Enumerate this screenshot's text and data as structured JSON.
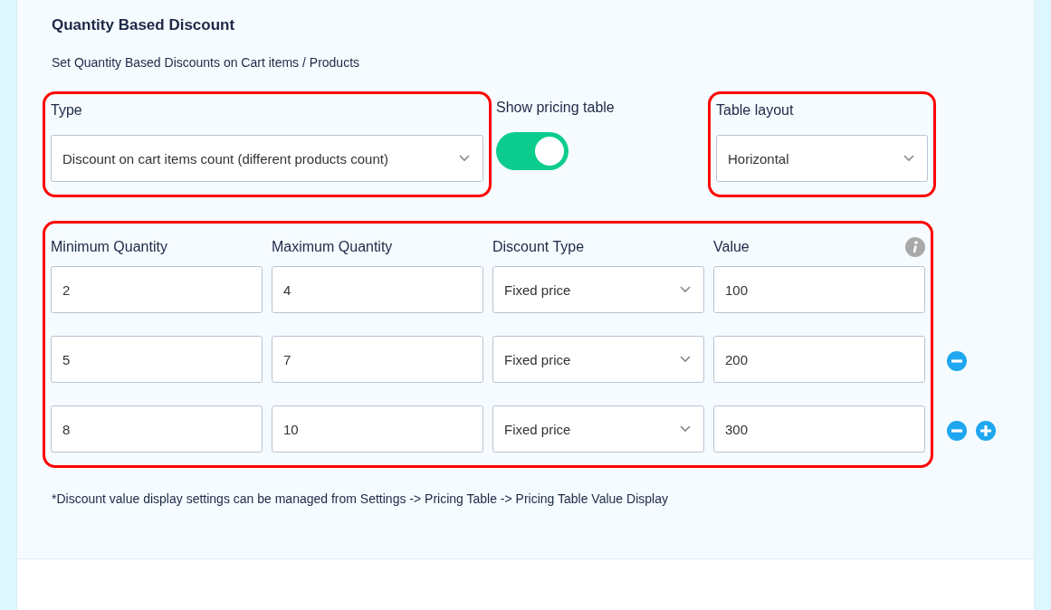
{
  "title": "Quantity Based Discount",
  "subtitle": "Set Quantity Based Discounts on Cart items / Products",
  "type_field": {
    "label": "Type",
    "value": "Discount on cart items count (different products count)"
  },
  "pricing_toggle": {
    "label": "Show pricing table",
    "on": true
  },
  "layout_field": {
    "label": "Table layout",
    "value": "Horizontal"
  },
  "table": {
    "columns": [
      "Minimum Quantity",
      "Maximum Quantity",
      "Discount Type",
      "Value"
    ],
    "rows": [
      {
        "min": "2",
        "max": "4",
        "discount_type": "Fixed price",
        "value": "100",
        "removable": false,
        "addable": false
      },
      {
        "min": "5",
        "max": "7",
        "discount_type": "Fixed price",
        "value": "200",
        "removable": true,
        "addable": false
      },
      {
        "min": "8",
        "max": "10",
        "discount_type": "Fixed price",
        "value": "300",
        "removable": true,
        "addable": true
      }
    ]
  },
  "note": "*Discount value display settings can be managed from Settings -> Pricing Table -> Pricing Table Value Display"
}
